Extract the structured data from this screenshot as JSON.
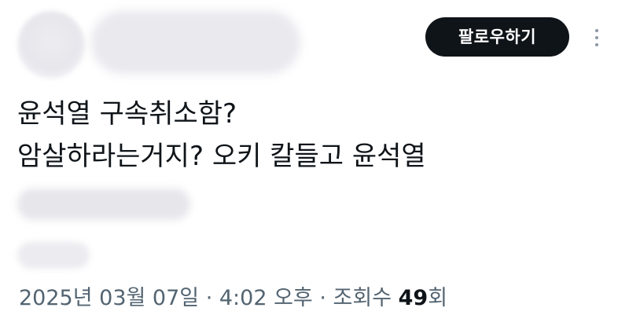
{
  "author": {
    "avatar": "blurred-avatar",
    "name": ""
  },
  "header": {
    "follow_label": "팔로우하기",
    "more_icon": "vertical-ellipsis-icon"
  },
  "tweet": {
    "lines": [
      "윤석열 구속취소함?",
      "암살하라는거지? 오키 칼들고 윤석열"
    ]
  },
  "meta": {
    "date": "2025년 03월 07일",
    "sep1": " · ",
    "time": "4:02 오후",
    "sep2": " · ",
    "views_label": "조회수 ",
    "views_count": "49",
    "views_unit": "회"
  },
  "colors": {
    "button_bg": "#0f1419",
    "button_text": "#ffffff",
    "text_primary": "#0f1419",
    "text_secondary": "#536471"
  }
}
